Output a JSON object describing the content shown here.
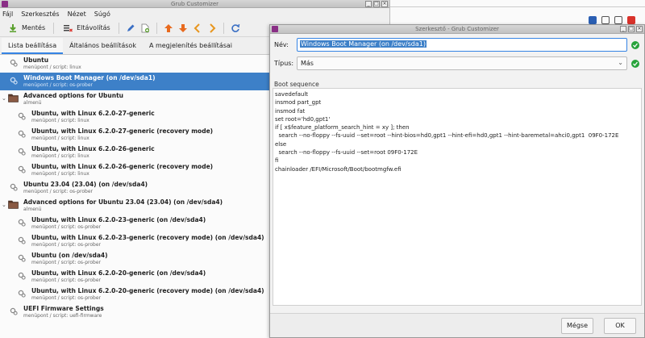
{
  "background": {},
  "main_window": {
    "title": "Grub Customizer",
    "menu": [
      "Fájl",
      "Szerkesztés",
      "Nézet",
      "Súgó"
    ],
    "toolbar": {
      "save_label": "Mentés",
      "remove_label": "Eltávolítás"
    },
    "tabs": [
      "Lista beállítása",
      "Általános beállítások",
      "A megjelenítés beállításai"
    ],
    "entries": [
      {
        "name": "Ubuntu",
        "sub": "menüpont / script: linux",
        "kind": "entry",
        "level": 0
      },
      {
        "name": "Windows Boot Manager (on /dev/sda1)",
        "sub": "menüpont / script: os-prober",
        "kind": "entry",
        "level": 0,
        "selected": true
      },
      {
        "name": "Advanced options for Ubuntu",
        "sub": "almenü",
        "kind": "submenu",
        "level": 0
      },
      {
        "name": "Ubuntu, with Linux 6.2.0-27-generic",
        "sub": "menüpont / script: linux",
        "kind": "entry",
        "level": 1
      },
      {
        "name": "Ubuntu, with Linux 6.2.0-27-generic (recovery mode)",
        "sub": "menüpont / script: linux",
        "kind": "entry",
        "level": 1
      },
      {
        "name": "Ubuntu, with Linux 6.2.0-26-generic",
        "sub": "menüpont / script: linux",
        "kind": "entry",
        "level": 1
      },
      {
        "name": "Ubuntu, with Linux 6.2.0-26-generic (recovery mode)",
        "sub": "menüpont / script: linux",
        "kind": "entry",
        "level": 1
      },
      {
        "name": "Ubuntu 23.04 (23.04) (on /dev/sda4)",
        "sub": "menüpont / script: os-prober",
        "kind": "entry",
        "level": 0
      },
      {
        "name": "Advanced options for Ubuntu 23.04 (23.04) (on /dev/sda4)",
        "sub": "almenü",
        "kind": "submenu",
        "level": 0
      },
      {
        "name": "Ubuntu, with Linux 6.2.0-23-generic (on /dev/sda4)",
        "sub": "menüpont / script: os-prober",
        "kind": "entry",
        "level": 1
      },
      {
        "name": "Ubuntu, with Linux 6.2.0-23-generic (recovery mode) (on /dev/sda4)",
        "sub": "menüpont / script: os-prober",
        "kind": "entry",
        "level": 1
      },
      {
        "name": "Ubuntu (on /dev/sda4)",
        "sub": "menüpont / script: os-prober",
        "kind": "entry",
        "level": 1
      },
      {
        "name": "Ubuntu, with Linux 6.2.0-20-generic (on /dev/sda4)",
        "sub": "menüpont / script: os-prober",
        "kind": "entry",
        "level": 1
      },
      {
        "name": "Ubuntu, with Linux 6.2.0-20-generic (recovery mode) (on /dev/sda4)",
        "sub": "menüpont / script: os-prober",
        "kind": "entry",
        "level": 1
      },
      {
        "name": "UEFI Firmware Settings",
        "sub": "menüpont / script: uefi-firmware",
        "kind": "entry",
        "level": 0
      }
    ]
  },
  "dialog": {
    "title": "Szerkesztő - Grub Customizer",
    "name_label": "Név:",
    "name_value": "Windows Boot Manager (on /dev/sda1)",
    "type_label": "Típus:",
    "type_value": "Más",
    "sequence_label": "Boot sequence",
    "sequence_lines": [
      "savedefault",
      "insmod part_gpt",
      "insmod fat",
      "set root='hd0,gpt1'",
      "if [ x$feature_platform_search_hint = xy ]; then",
      "  search --no-floppy --fs-uuid --set=root --hint-bios=hd0,gpt1 --hint-efi=hd0,gpt1 --hint-baremetal=ahci0,gpt1  09F0-172E",
      "else",
      "  search --no-floppy --fs-uuid --set=root 09F0-172E",
      "fi",
      "chainloader /EFI/Microsoft/Boot/bootmgfw.efi"
    ],
    "cancel_label": "Mégse",
    "ok_label": "OK"
  },
  "colors": {
    "selection": "#3d80c8",
    "accent": "#3584e4",
    "valid_green": "#27a33b"
  }
}
